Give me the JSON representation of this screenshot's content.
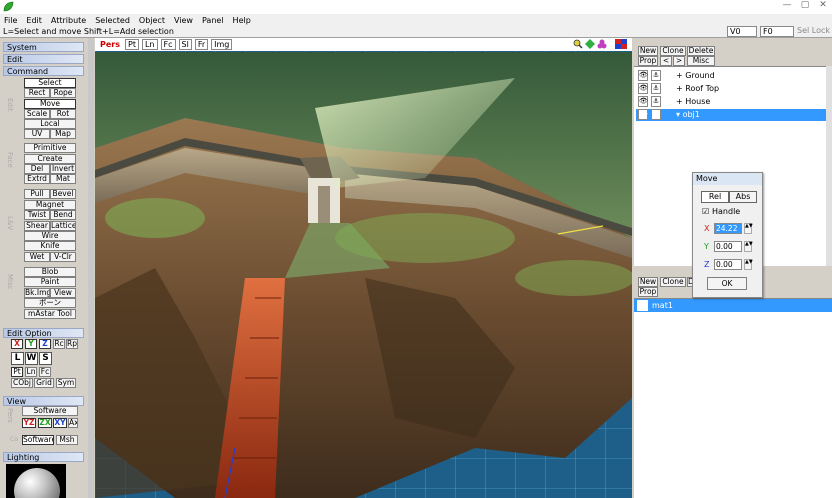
{
  "window": {
    "min": "—",
    "max": "▢",
    "close": "✕"
  },
  "menu": [
    "File",
    "Edit",
    "Attribute",
    "Selected",
    "Object",
    "View",
    "Panel",
    "Help"
  ],
  "status": {
    "hint": "L=Select and move  Shift+L=Add selection",
    "v": "V0",
    "f": "F0",
    "sel_lock": "Sel Lock"
  },
  "left": {
    "sections": {
      "system": "System",
      "edit": "Edit",
      "command": "Command",
      "edit_option": "Edit Option",
      "view": "View",
      "lighting": "Lighting"
    },
    "group_labels": {
      "edit": "Edit",
      "face": "Face",
      "lev": "L&V",
      "misc": "Misc",
      "pers": "Pers",
      "co": "Co"
    },
    "cmd": {
      "select": "Select",
      "rect": "Rect",
      "rope": "Rope",
      "move": "Move",
      "scale": "Scale",
      "rot": "Rot",
      "local": "Local",
      "uv": "UV",
      "map": "Map",
      "primitive": "Primitive",
      "create": "Create",
      "del": "Del",
      "invert": "Invert",
      "extrd": "Extrd",
      "mat": "Mat",
      "pull": "Pull",
      "bevel": "Bevel",
      "magnet": "Magnet",
      "twist": "Twist",
      "bend": "Bend",
      "shear": "Shear",
      "lattice": "Lattice",
      "wire": "Wire",
      "knife": "Knife",
      "wet": "Wet",
      "vclr": "V-Clr",
      "blob": "Blob",
      "paint": "Paint",
      "bkimg": "Bk.Img",
      "view": "View",
      "bone": "ボーン",
      "mastar": "mAstar Tool"
    },
    "opt": {
      "x": "X",
      "y": "Y",
      "z": "Z",
      "rc": "Rc",
      "rp": "Rp",
      "l": "L",
      "w": "W",
      "s": "S",
      "pt": "Pt",
      "ln": "Ln",
      "fc": "Fc",
      "cobj": "CObj",
      "grid": "Grid",
      "sym": "Sym"
    },
    "view": {
      "software": "Software",
      "yz": "YZ",
      "zx": "ZX",
      "xy": "XY",
      "ax": "Ax",
      "software2": "Software",
      "msh": "Msh"
    }
  },
  "viewport": {
    "tabs": [
      "Pers",
      "Pt",
      "Ln",
      "Fc",
      "Sl",
      "Fr",
      "Img"
    ]
  },
  "objpanel": {
    "new": "New",
    "clone": "Clone",
    "delete": "Delete",
    "prop": "Prop",
    "prev": "<",
    "next": ">",
    "misc": "Misc",
    "objects": [
      {
        "name": "Ground",
        "prefix": "+",
        "selected": false
      },
      {
        "name": "Roof Top",
        "prefix": "+",
        "selected": false
      },
      {
        "name": "House",
        "prefix": "+",
        "selected": false
      },
      {
        "name": "obj1",
        "prefix": "▾",
        "selected": true
      }
    ]
  },
  "matpanel": {
    "new": "New",
    "clone": "Clone",
    "d": "D",
    "prop": "Prop",
    "materials": [
      {
        "name": "mat1",
        "selected": true
      }
    ]
  },
  "move_dialog": {
    "title": "Move",
    "rel": "Rel",
    "abs": "Abs",
    "handle_check": "☑",
    "handle": "Handle",
    "x_label": "X",
    "x": "24.22",
    "y_label": "Y",
    "y": "0.00",
    "z_label": "Z",
    "z": "0.00",
    "ok": "OK"
  },
  "colors": {
    "x_axis": "#d02020",
    "y_axis": "#20a020",
    "z_axis": "#2040d0",
    "selection": "#3399ff"
  }
}
